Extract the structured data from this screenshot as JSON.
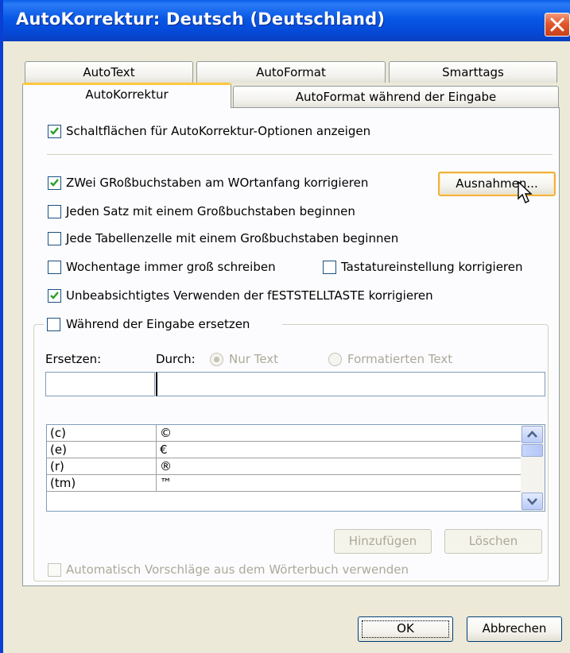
{
  "window": {
    "title": "AutoKorrektur: Deutsch (Deutschland)"
  },
  "tabs": {
    "row1": [
      "AutoText",
      "AutoFormat",
      "Smarttags"
    ],
    "row2": [
      "AutoKorrektur",
      "AutoFormat während der Eingabe"
    ],
    "active": "AutoKorrektur"
  },
  "options": {
    "show_buttons": {
      "label": "Schaltflächen für AutoKorrektur-Optionen anzeigen",
      "checked": true
    },
    "two_caps": {
      "label": "ZWei GRoßbuchstaben am WOrtanfang korrigieren",
      "checked": true
    },
    "exceptions_button": "Ausnahmen...",
    "sentence_cap": {
      "label": "Jeden Satz mit einem Großbuchstaben beginnen",
      "checked": false
    },
    "table_cell_cap": {
      "label": "Jede Tabellenzelle mit einem Großbuchstaben beginnen",
      "checked": false
    },
    "weekdays": {
      "label": "Wochentage immer groß schreiben",
      "checked": false
    },
    "keyboard": {
      "label": "Tastatureinstellung korrigieren",
      "checked": false
    },
    "caps_lock": {
      "label": "Unbeabsichtigtes Verwenden der fESTSTELLTASTE korrigieren",
      "checked": true
    }
  },
  "replace_group": {
    "title": "Während der Eingabe ersetzen",
    "checked": false,
    "replace_label": "Ersetzen:",
    "with_label": "Durch:",
    "radio_plain": "Nur Text",
    "radio_formatted": "Formatierten Text",
    "replace_value": "",
    "with_value": "",
    "entries": [
      {
        "from": "(c)",
        "to": "©"
      },
      {
        "from": "(e)",
        "to": "€"
      },
      {
        "from": "(r)",
        "to": "®"
      },
      {
        "from": "(tm)",
        "to": "™"
      }
    ],
    "add_button": "Hinzufügen",
    "delete_button": "Löschen",
    "dictionary_suggestions": {
      "label": "Automatisch Vorschläge aus dem Wörterbuch verwenden",
      "checked": false
    }
  },
  "footer": {
    "ok": "OK",
    "cancel": "Abbrechen"
  },
  "colors": {
    "titlebar": "#0854E3",
    "dialog_bg": "#ECE9D8",
    "panel_bg": "#FCFCFE",
    "tab_highlight": "#FFC83C",
    "close_button": "#E2572C",
    "check": "#21A121"
  }
}
